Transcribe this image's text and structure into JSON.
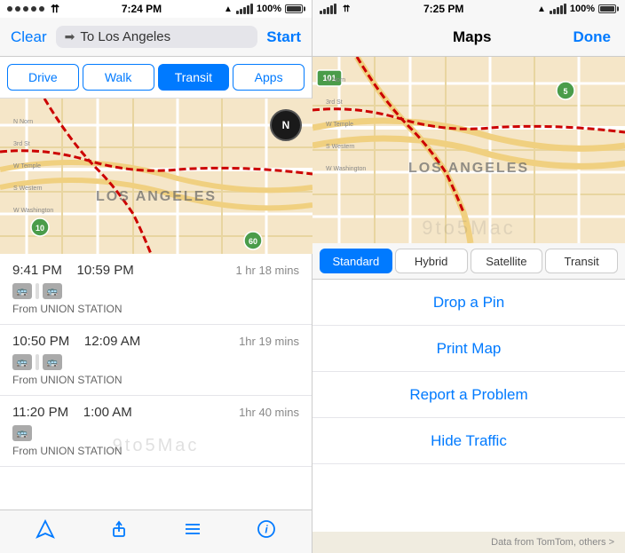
{
  "left": {
    "status": {
      "dots": 5,
      "time": "7:24 PM",
      "gps": "▲",
      "signal": "●●●●●",
      "wifi": "WiFi",
      "percent": "100%",
      "battery": "🔋"
    },
    "nav": {
      "clear_label": "Clear",
      "destination": "To Los Angeles",
      "start_label": "Start"
    },
    "tabs": [
      {
        "label": "Drive",
        "active": false
      },
      {
        "label": "Walk",
        "active": false
      },
      {
        "label": "Transit",
        "active": true
      },
      {
        "label": "Apps",
        "active": false
      }
    ],
    "routes": [
      {
        "depart": "9:41 PM",
        "arrive": "10:59 PM",
        "duration": "1 hr 18 mins",
        "station": "From UNION STATION"
      },
      {
        "depart": "10:50 PM",
        "arrive": "12:09 AM",
        "duration": "1hr 19 mins",
        "station": "From UNION STATION"
      },
      {
        "depart": "11:20 PM",
        "arrive": "1:00 AM",
        "duration": "1hr 40 mins",
        "station": "From UNION STATION"
      }
    ],
    "toolbar": {
      "location_icon": "↑",
      "share_icon": "⬆",
      "list_icon": "≡",
      "info_icon": "ℹ"
    }
  },
  "right": {
    "status": {
      "time": "7:25 PM",
      "gps": "▲",
      "signal": "●●●●●",
      "percent": "100%"
    },
    "nav": {
      "title": "Maps",
      "done_label": "Done"
    },
    "map_types": [
      {
        "label": "Standard",
        "active": true
      },
      {
        "label": "Hybrid",
        "active": false
      },
      {
        "label": "Satellite",
        "active": false
      },
      {
        "label": "Transit",
        "active": false
      }
    ],
    "menu_items": [
      {
        "label": "Drop a Pin"
      },
      {
        "label": "Print Map"
      },
      {
        "label": "Report a Problem"
      },
      {
        "label": "Hide Traffic"
      }
    ],
    "bottom_info": "Data from TomTom, others >"
  }
}
